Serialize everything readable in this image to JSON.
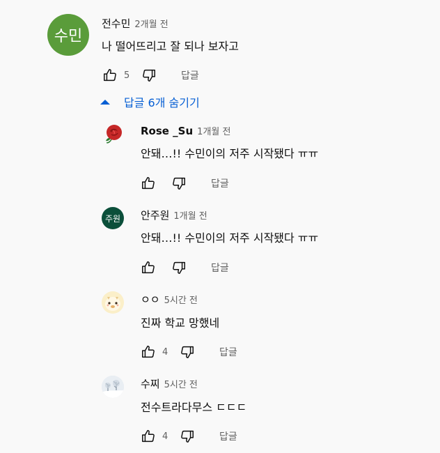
{
  "top_comment": {
    "avatar_text": "수민",
    "avatar_color": "#5a9c3a",
    "author": "전수민",
    "time": "2개월 전",
    "text": "나 떨어뜨리고 잘 되나 보자고",
    "likes": "5",
    "reply": "답글"
  },
  "toggle": {
    "label": "답글 6개 숨기기"
  },
  "replies": [
    {
      "author": "Rose _Su",
      "time": "1개월 전",
      "text": "안돼…!! 수민이의 저주 시작됐다 ㅠㅠ",
      "likes": "",
      "reply": "답글",
      "avatar": "rose-icon"
    },
    {
      "author": "안주원",
      "time": "1개월 전",
      "text": "안돼…!! 수민이의 저주 시작됐다 ㅠㅠ",
      "likes": "",
      "reply": "답글",
      "avatar_text": "주원",
      "avatar_color": "#0b4f3a"
    },
    {
      "author": "ㅇㅇ",
      "time": "5시간 전",
      "text": "진짜 학교 망했네",
      "likes": "4",
      "reply": "답글",
      "avatar": "alpaca-icon"
    },
    {
      "author": "수찌",
      "time": "5시간 전",
      "text": "전수트라다무스 ㄷㄷㄷ",
      "likes": "4",
      "reply": "답글",
      "avatar": "snow-landscape-icon"
    }
  ]
}
